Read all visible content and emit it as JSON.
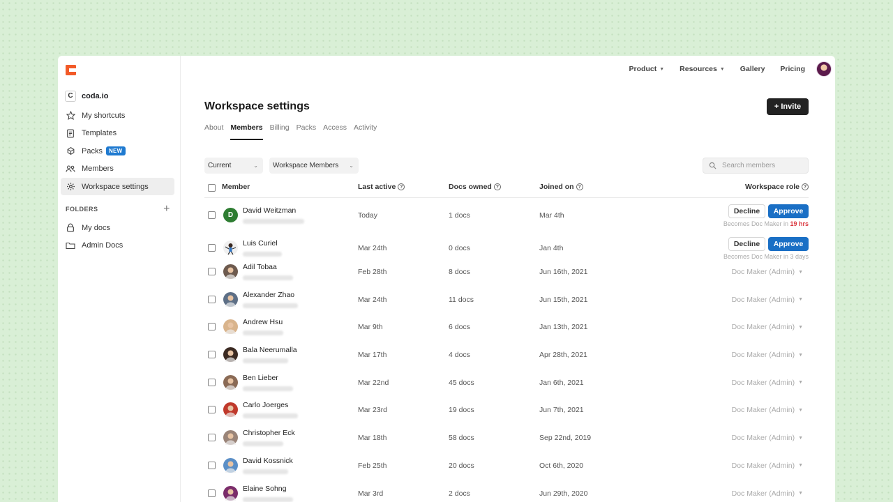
{
  "colors": {
    "brand": "#f25a28",
    "accent": "#1a6fc5",
    "urgent": "#d9363e",
    "background": "#d9efd6"
  },
  "sidebar": {
    "workspace": {
      "badge": "C",
      "name": "coda.io"
    },
    "items": [
      {
        "label": "My shortcuts",
        "icon": "star-icon"
      },
      {
        "label": "Templates",
        "icon": "templates-icon"
      },
      {
        "label": "Packs",
        "icon": "packs-icon",
        "badge": "NEW"
      },
      {
        "label": "Members",
        "icon": "members-icon"
      },
      {
        "label": "Workspace settings",
        "icon": "gear-icon",
        "active": true
      }
    ],
    "folders_heading": "FOLDERS",
    "add_folder": "+",
    "folders": [
      {
        "label": "My docs",
        "icon": "lock-icon"
      },
      {
        "label": "Admin Docs",
        "icon": "folder-icon"
      }
    ]
  },
  "topnav": {
    "product": "Product",
    "resources": "Resources",
    "gallery": "Gallery",
    "pricing": "Pricing"
  },
  "page": {
    "title": "Workspace settings",
    "invite": "+ Invite",
    "tabs": [
      "About",
      "Members",
      "Billing",
      "Packs",
      "Access",
      "Activity"
    ],
    "active_tab": "Members"
  },
  "filters": {
    "status": "Current",
    "group": "Workspace Members",
    "search_placeholder": "Search members"
  },
  "table": {
    "headers": {
      "member": "Member",
      "last_active": "Last active",
      "docs_owned": "Docs owned",
      "joined_on": "Joined on",
      "workspace_role": "Workspace role"
    },
    "help_icon": "?",
    "decline": "Decline",
    "approve": "Approve",
    "rows": [
      {
        "name": "David Weitzman",
        "last_active": "Today",
        "docs": "1 docs",
        "joined": "Mar 4th",
        "avatar": "D",
        "avatar_color": "#2e7d32",
        "pending": true,
        "becomes_prefix": "Becomes Doc Maker in ",
        "becomes_time": "19 hrs"
      },
      {
        "name": "Luis Curiel",
        "last_active": "Mar 24th",
        "docs": "0 docs",
        "joined": "Jan 4th",
        "avatar": "",
        "avatar_color": "#f0f0f0",
        "pending": true,
        "becomes_prefix": "Becomes Doc Maker in 3 days",
        "becomes_time": ""
      },
      {
        "name": "Adil Tobaa",
        "last_active": "Feb 28th",
        "docs": "8 docs",
        "joined": "Jun 16th, 2021",
        "avatar": "",
        "avatar_color": "#6d5a4e",
        "role": "Doc Maker (Admin)"
      },
      {
        "name": "Alexander Zhao",
        "last_active": "Mar 24th",
        "docs": "11 docs",
        "joined": "Jun 15th, 2021",
        "avatar": "",
        "avatar_color": "#5d6f86",
        "role": "Doc Maker (Admin)"
      },
      {
        "name": "Andrew Hsu",
        "last_active": "Mar 9th",
        "docs": "6 docs",
        "joined": "Jan 13th, 2021",
        "avatar": "",
        "avatar_color": "#d9b48c",
        "role": "Doc Maker (Admin)"
      },
      {
        "name": "Bala Neerumalla",
        "last_active": "Mar 17th",
        "docs": "4 docs",
        "joined": "Apr 28th, 2021",
        "avatar": "",
        "avatar_color": "#3b2a22",
        "role": "Doc Maker (Admin)"
      },
      {
        "name": "Ben Lieber",
        "last_active": "Mar 22nd",
        "docs": "45 docs",
        "joined": "Jan 6th, 2021",
        "avatar": "",
        "avatar_color": "#8a6a55",
        "role": "Doc Maker (Admin)"
      },
      {
        "name": "Carlo Joerges",
        "last_active": "Mar 23rd",
        "docs": "19 docs",
        "joined": "Jun 7th, 2021",
        "avatar": "",
        "avatar_color": "#c0392b",
        "role": "Doc Maker (Admin)"
      },
      {
        "name": "Christopher Eck",
        "last_active": "Mar 18th",
        "docs": "58 docs",
        "joined": "Sep 22nd, 2019",
        "avatar": "",
        "avatar_color": "#9a8478",
        "role": "Doc Maker (Admin)"
      },
      {
        "name": "David Kossnick",
        "last_active": "Feb 25th",
        "docs": "20 docs",
        "joined": "Oct 6th, 2020",
        "avatar": "",
        "avatar_color": "#5b8fc7",
        "role": "Doc Maker (Admin)"
      },
      {
        "name": "Elaine Sohng",
        "last_active": "Mar 3rd",
        "docs": "2 docs",
        "joined": "Jun 29th, 2020",
        "avatar": "",
        "avatar_color": "#7b2d6b",
        "role": "Doc Maker (Admin)"
      }
    ]
  }
}
